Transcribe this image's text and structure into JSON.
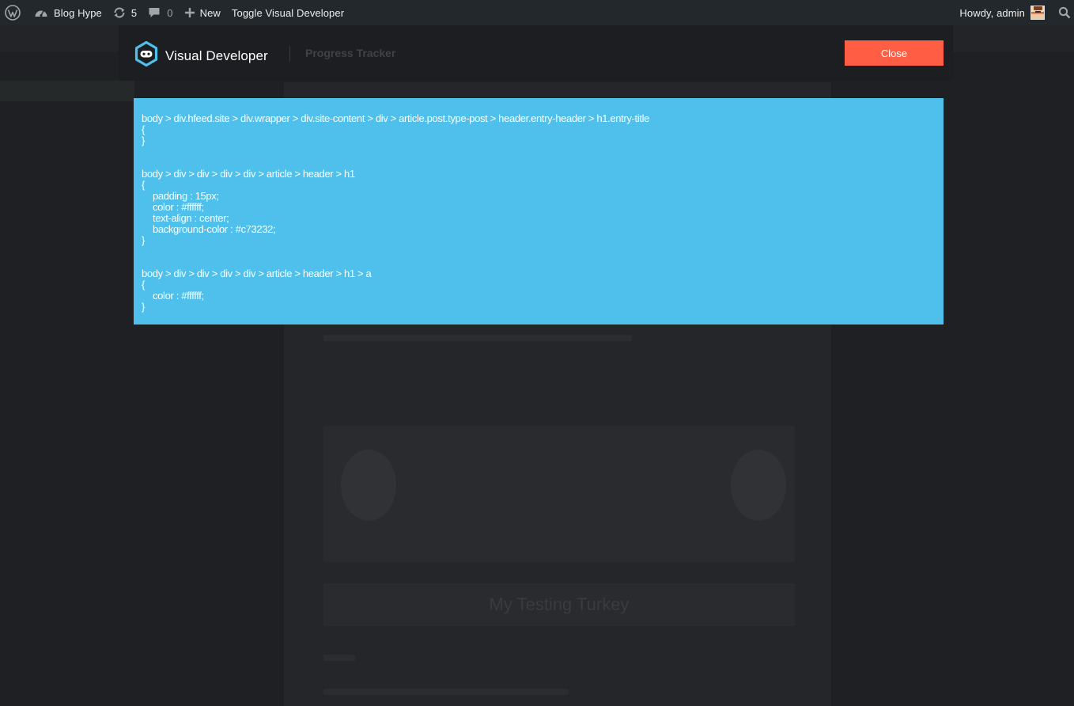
{
  "adminbar": {
    "site_name": "Blog Hype",
    "updates_count": "5",
    "comments_count": "0",
    "new_label": "New",
    "toggle_label": "Toggle Visual Developer",
    "howdy": "Howdy, admin"
  },
  "vd": {
    "logo_text": "Visual Developer",
    "tab_label": "Progress Tracker",
    "close_label": "Close",
    "panel_bg": "#4fc0ec",
    "close_bg": "#ff5e44"
  },
  "css_rules": [
    {
      "selector": "body > div.hfeed.site > div.wrapper > div.site-content > div > article.post.type-post > header.entry-header > h1.entry-title",
      "open": "{",
      "declarations": [],
      "close": "}"
    },
    {
      "selector": "body > div > div > div > div > article > header > h1",
      "open": "{",
      "declarations": [
        "padding : 15px;",
        "color : #ffffff;",
        "text-align : center;",
        "background-color : #c73232;"
      ],
      "close": "}"
    },
    {
      "selector": "body > div > div > div > div > article > header > h1 > a",
      "open": "{",
      "declarations": [
        "color : #ffffff;"
      ],
      "close": "}"
    }
  ],
  "background": {
    "banner_title": "My Testing Turkey"
  }
}
